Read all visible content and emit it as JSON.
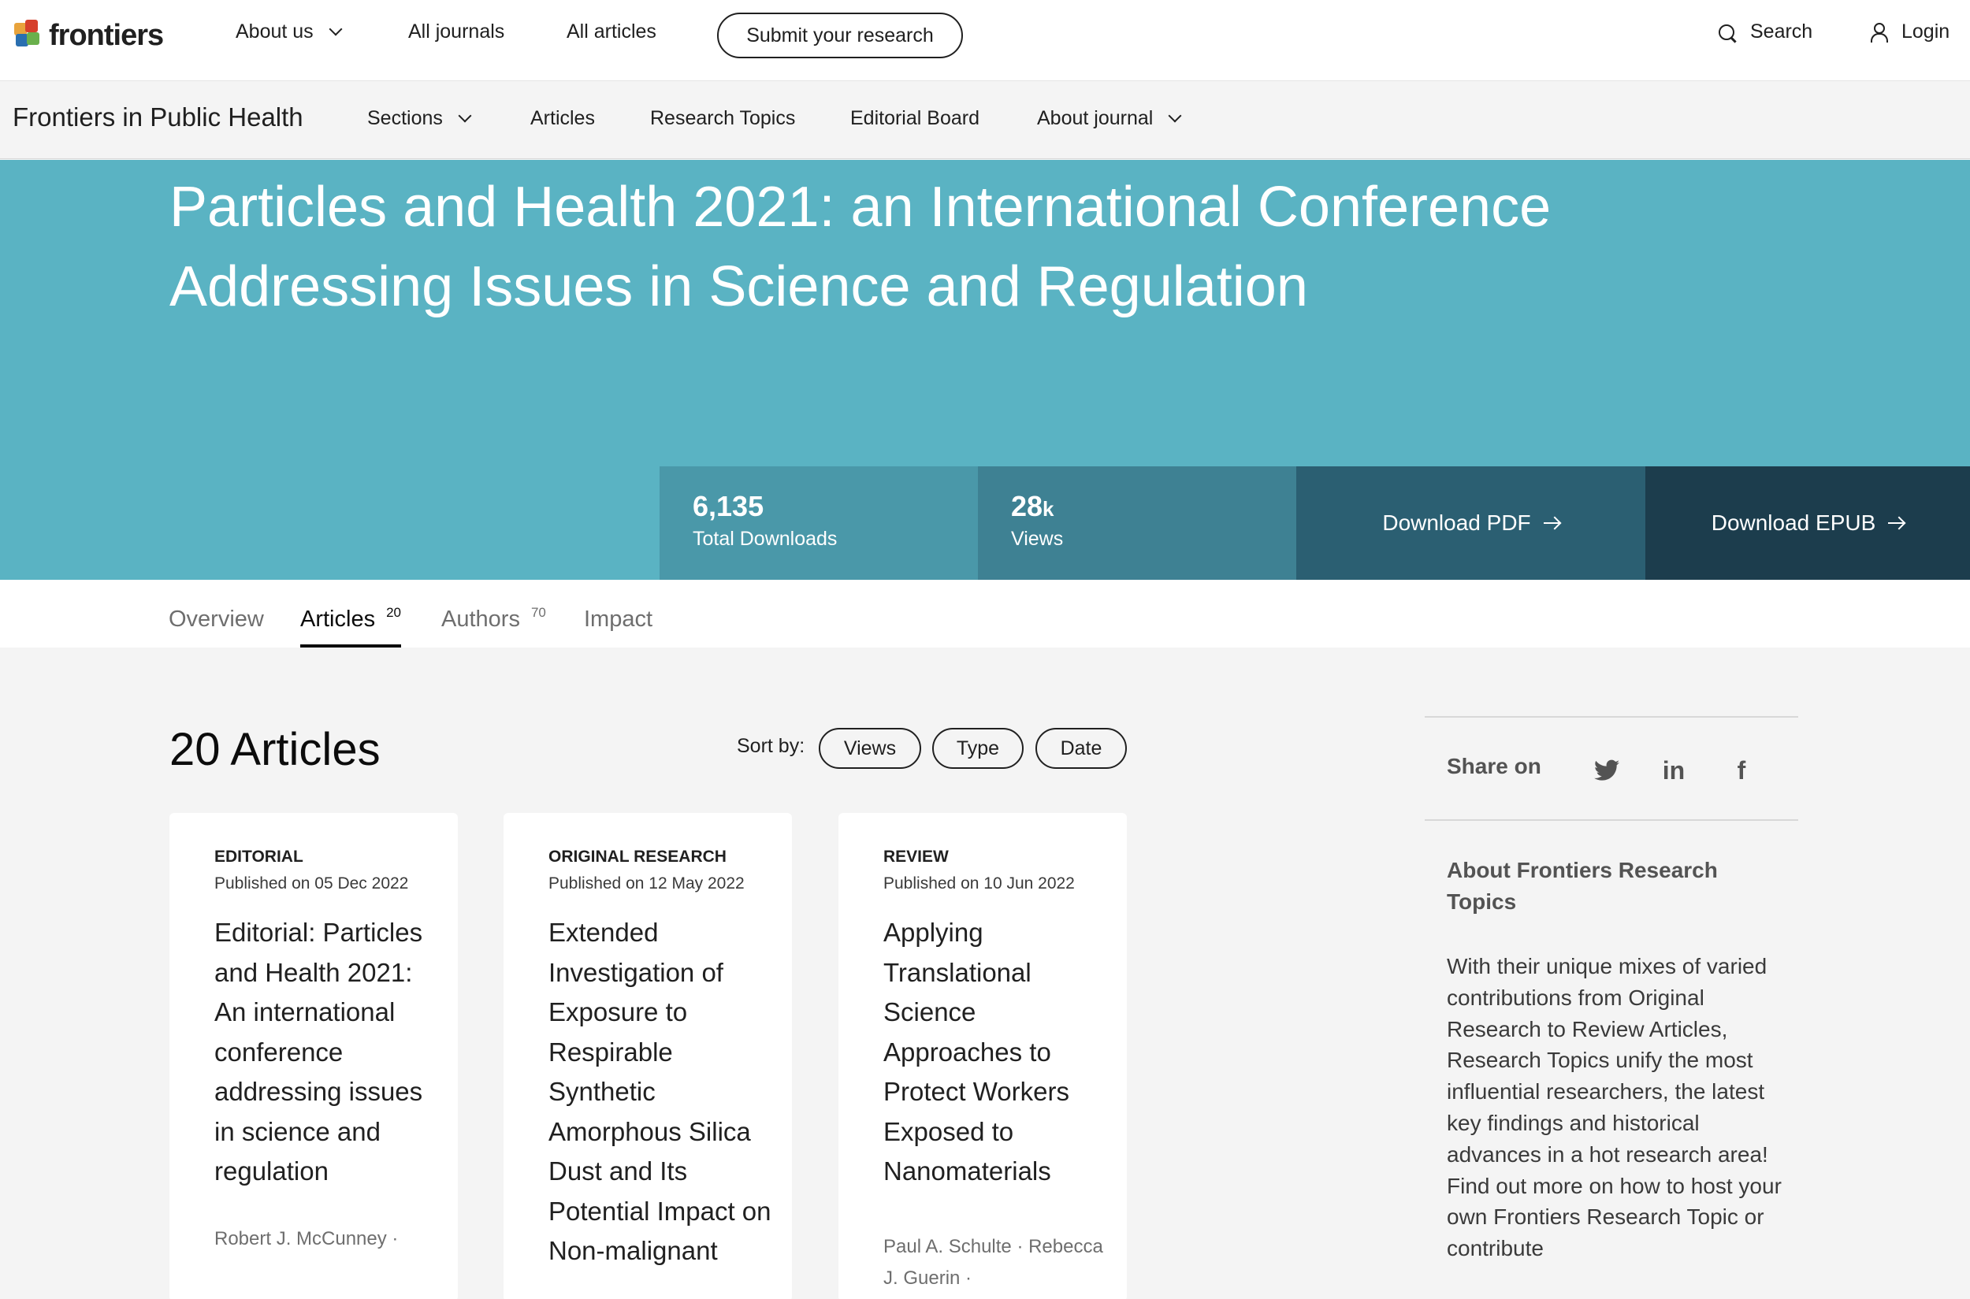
{
  "topnav": {
    "logo_text": "frontiers",
    "about_us": "About us",
    "all_journals": "All journals",
    "all_articles": "All articles",
    "submit": "Submit your research",
    "search": "Search",
    "login": "Login"
  },
  "journal_nav": {
    "name": "Frontiers in Public Health",
    "sections": "Sections",
    "articles": "Articles",
    "research_topics": "Research Topics",
    "editorial_board": "Editorial Board",
    "about_journal": "About journal"
  },
  "hero": {
    "title": "Particles and Health 2021: an International Conference Addressing Issues in Science and Regulation",
    "downloads_value": "6,135",
    "downloads_label": "Total Downloads",
    "views_value": "28",
    "views_unit": "k",
    "views_label": "Views",
    "download_pdf": "Download PDF",
    "download_epub": "Download EPUB"
  },
  "tabs": {
    "overview": "Overview",
    "articles": "Articles",
    "articles_count": "20",
    "authors": "Authors",
    "authors_count": "70",
    "impact": "Impact"
  },
  "articles_section": {
    "heading": "20 Articles",
    "sort_label": "Sort by:",
    "sort_views": "Views",
    "sort_type": "Type",
    "sort_date": "Date"
  },
  "cards": [
    {
      "type": "EDITORIAL",
      "published": "Published on 05 Dec 2022",
      "title": "Editorial: Particles and Health 2021: An international conference addressing issues in science and regulation",
      "authors": "Robert J. McCunney ·"
    },
    {
      "type": "ORIGINAL RESEARCH",
      "published": "Published on 12 May 2022",
      "title": "Extended Investigation of Exposure to Respirable Synthetic Amorphous Silica Dust and Its Potential Impact on Non-malignant",
      "authors": ""
    },
    {
      "type": "REVIEW",
      "published": "Published on 10 Jun 2022",
      "title": "Applying Translational Science Approaches to Protect Workers Exposed to Nanomaterials",
      "authors": "Paul A. Schulte · Rebecca J. Guerin ·"
    }
  ],
  "sidebar": {
    "share_label": "Share on",
    "twitter": "twitter-icon",
    "linkedin": "in",
    "facebook": "f",
    "about_title": "About Frontiers Research Topics",
    "about_text": "With their unique mixes of varied contributions from Original Research to Review Articles, Research Topics unify the most influential researchers, the latest key findings and historical advances in a hot research area! Find out more on how to host your own Frontiers Research Topic or contribute"
  },
  "colors": {
    "hero": "#5ab3c3",
    "stat_downloads": "#4a98a9",
    "stat_views": "#3e8193",
    "download_pdf": "#2b5f72",
    "download_epub": "#1c3d4d"
  }
}
